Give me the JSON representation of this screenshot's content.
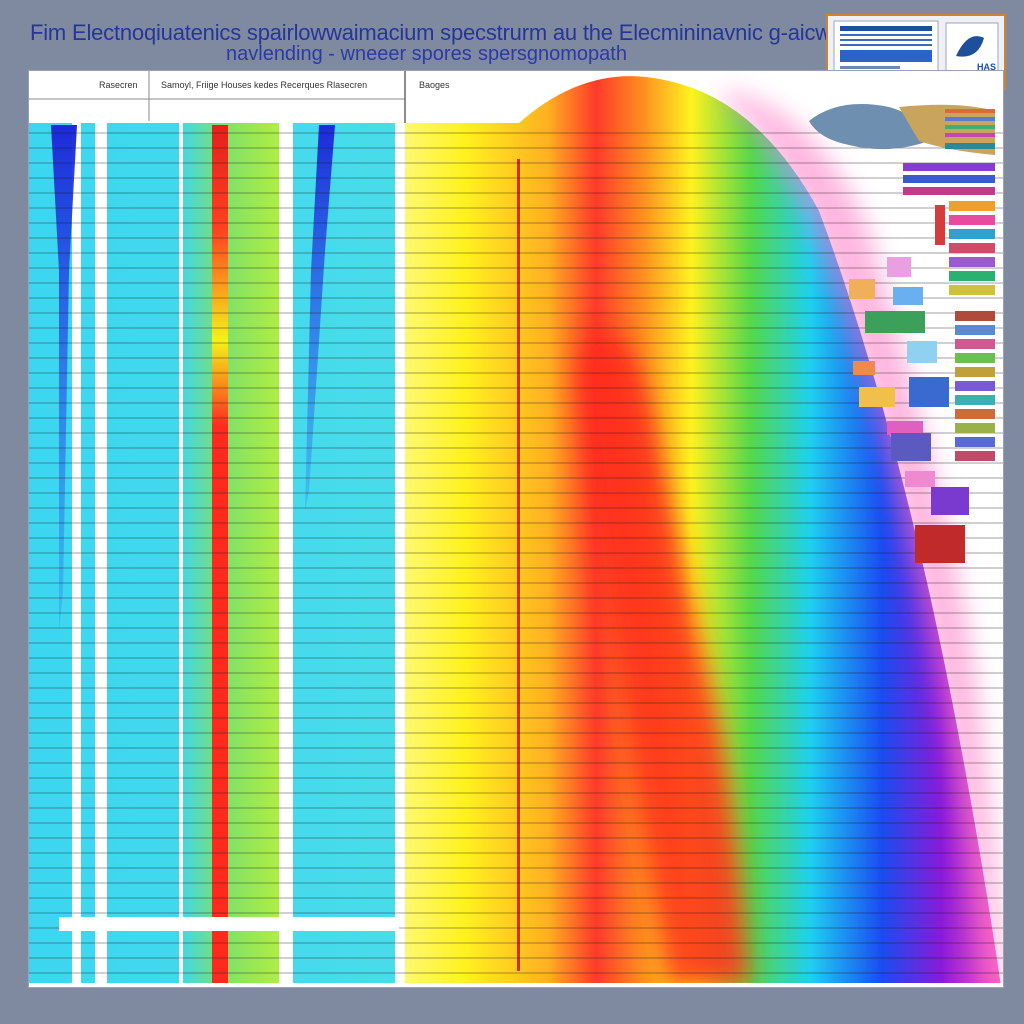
{
  "title": {
    "line1": "Fim Electnoqiuatenics spairlowwaimacium specstrurm au the Elecmininavnic g-aicws",
    "line2": "navlending - wneeer spores",
    "line3": "spersgnomopath"
  },
  "table_headers": {
    "col1": "Rasecren",
    "col2": "Samoyl, Friige Houses kedes Recerques Rlasecren",
    "col3": "Baoges"
  },
  "badge": {
    "text": "HAS",
    "accent_color": "#1d4f9c",
    "border_color": "#c98434"
  },
  "colors": {
    "background": "#7f8aa0",
    "title": "#26359a",
    "panel": "#ffffff",
    "cyan_band": "#3fd7ef",
    "spectrum": [
      "#ff3a2a",
      "#ff8a20",
      "#fff21f",
      "#55d84a",
      "#1ed0f0",
      "#1a4cf0",
      "#8a1ad8",
      "#ff5cc0"
    ]
  },
  "icons": {
    "badge_logo": "leaf-icon",
    "sidebar_shape": "blob-shape-icon"
  }
}
